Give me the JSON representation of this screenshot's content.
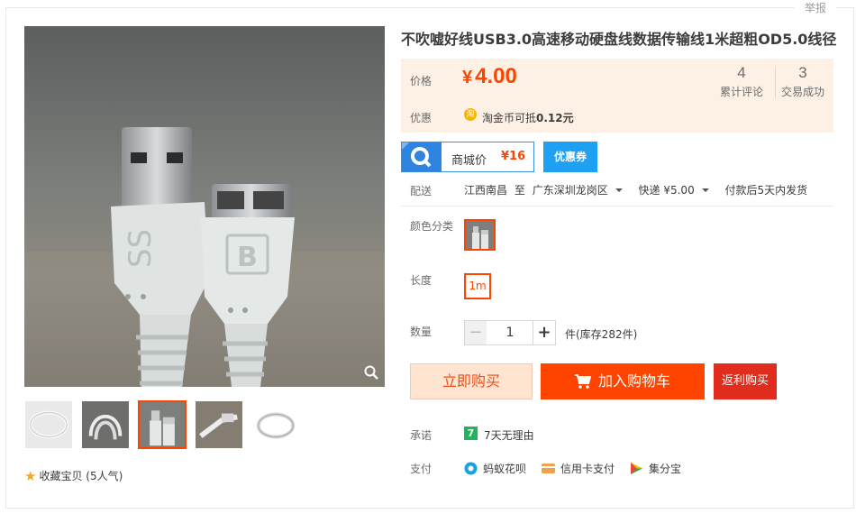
{
  "header": {
    "report_label": "举报"
  },
  "product": {
    "title": "不吹嘘好线USB3.0高速移动硬盘线数据传输线1米超粗OD5.0线径"
  },
  "price_box": {
    "price_label": "价格",
    "currency": "¥",
    "price": "4.00",
    "reviews_count": "4",
    "reviews_label": "累计评论",
    "deals_count": "3",
    "deals_label": "交易成功",
    "promo_label": "优惠",
    "coin_icon_text": "淘",
    "coin_text_prefix": "淘金币可抵",
    "coin_amount": "0.12元"
  },
  "mall": {
    "label": "商城价",
    "price": "¥16",
    "coupon_label": "优惠券"
  },
  "delivery": {
    "label": "配送",
    "from": "江西南昌",
    "to_word": "至",
    "dest": "广东深圳龙岗区",
    "shipping": "快递 ¥5.00",
    "ship_time": "付款后5天内发货"
  },
  "sku": {
    "color_label": "颜色分类",
    "length_label": "长度",
    "length_option": "1m",
    "qty_label": "数量",
    "qty_value": "1",
    "minus": "−",
    "plus": "+",
    "stock_text": "件(库存282件)"
  },
  "actions": {
    "buy_now": "立即购买",
    "add_cart": "加入购物车",
    "rebate": "返利购买"
  },
  "service": {
    "promise_label": "承诺",
    "promise_icon_text": "7",
    "promise_text": "7天无理由",
    "pay_label": "支付",
    "pay_methods": [
      "蚂蚁花呗",
      "信用卡支付",
      "集分宝"
    ]
  },
  "gallery": {
    "fav_text": "收藏宝贝",
    "fav_count": "(5人气)",
    "active_thumb": 2
  },
  "colors": {
    "accent": "#ff4400",
    "price_bg": "#fdf0e5",
    "mall_blue": "#2f84df",
    "coupon_blue": "#1ea1f3",
    "rebate_red": "#e12d1d"
  }
}
